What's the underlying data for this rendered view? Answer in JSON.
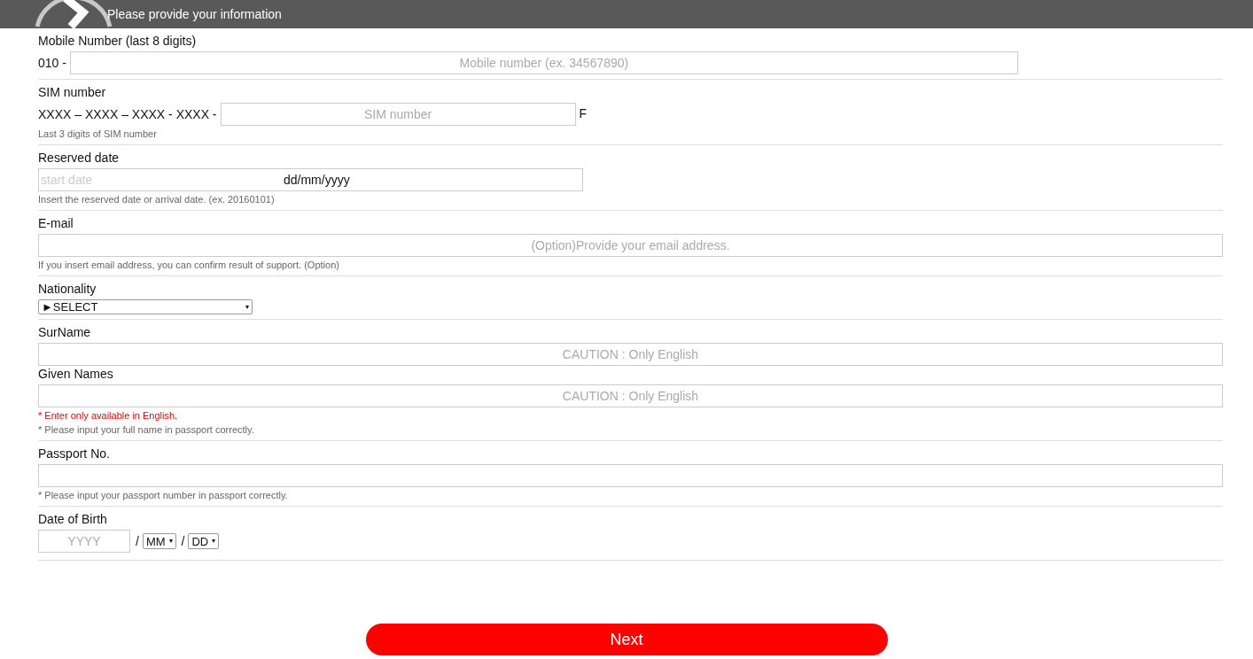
{
  "header": {
    "title": "Please provide your information"
  },
  "sections": [
    {
      "items": [
        {
          "kind": "label",
          "text": "Mobile Number (last 8 digits)"
        },
        {
          "kind": "long-input",
          "prefix": "010 -",
          "placeholder": "Mobile number (ex. 34567890)"
        }
      ]
    },
    {
      "items": [
        {
          "kind": "label",
          "text": "SIM number"
        },
        {
          "kind": "short-input",
          "prefix": "XXXX – XXXX – XXXX - XXXX -",
          "placeholder": "SIM number",
          "suffix": "F"
        },
        {
          "kind": "note",
          "text": "Last 3 digits of SIM number",
          "warning": false
        }
      ]
    },
    {
      "items": [
        {
          "kind": "label",
          "text": "Reserved date"
        },
        {
          "kind": "date",
          "placeholder": "start date",
          "format": "dd/mm/yyyy"
        },
        {
          "kind": "note",
          "text": "Insert the reserved date or arrival date. (ex. 20160101)",
          "warning": false
        }
      ]
    },
    {
      "items": [
        {
          "kind": "label",
          "text": "E-mail"
        },
        {
          "kind": "input",
          "placeholder": "(Option)Provide your email address."
        },
        {
          "kind": "note",
          "text": "If you insert email address, you can confirm result of support. (Option)",
          "warning": false
        }
      ]
    },
    {
      "items": [
        {
          "kind": "label",
          "text": "Nationality"
        },
        {
          "kind": "select",
          "value": "►SELECT"
        }
      ]
    },
    {
      "items": [
        {
          "kind": "label",
          "text": "SurName"
        },
        {
          "kind": "input",
          "placeholder": "CAUTION : Only English"
        },
        {
          "kind": "label",
          "text": "Given Names"
        },
        {
          "kind": "input",
          "placeholder": "CAUTION : Only English"
        },
        {
          "kind": "note",
          "text": "* Enter only available in English.",
          "warning": true
        },
        {
          "kind": "note",
          "text": "* Please input your full name in passport correctly.",
          "warning": false
        }
      ]
    },
    {
      "items": [
        {
          "kind": "label",
          "text": "Passport No."
        },
        {
          "kind": "input"
        },
        {
          "kind": "note",
          "text": "* Please input your passport number in passport correctly.",
          "warning": false
        }
      ]
    },
    {
      "items": [
        {
          "kind": "label",
          "text": "Date of Birth"
        },
        {
          "kind": "dob",
          "year_placeholder": "YYYY",
          "separator_1": "/",
          "month": "MM",
          "separator_2": "/",
          "day": "DD"
        }
      ]
    }
  ],
  "button": {
    "label": "Next"
  }
}
